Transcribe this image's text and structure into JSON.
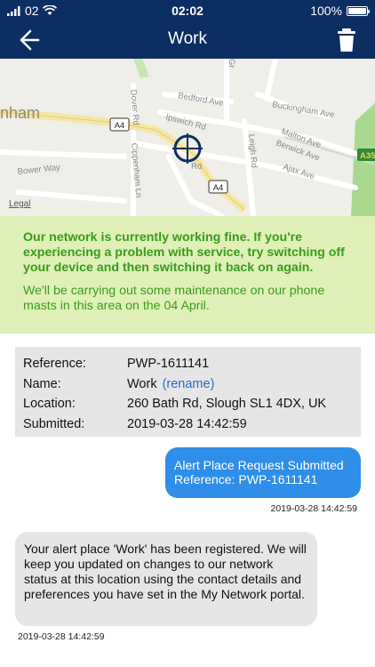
{
  "status_bar": {
    "carrier": "02",
    "time": "02:02",
    "battery_percent": "100%",
    "battery_level": 1.0
  },
  "nav": {
    "title": "Work",
    "back_icon": "back-arrow-icon",
    "delete_icon": "trash-icon"
  },
  "map": {
    "place_labels": {
      "town": "nham",
      "bedford": "Bedford Ave",
      "buckingham": "Buckingham Ave",
      "dover": "Dover Rd",
      "ipswich": "Ipswich Rd",
      "malton": "Malton Ave",
      "berwick": "Berwick Ave",
      "cippenham": "Cippenham Ln",
      "leigh": "Leigh Rd",
      "bower": "Bower Way",
      "ajax": "Ajax Ave",
      "rd": "Rd",
      "gr": "Gr"
    },
    "road_badges": {
      "a4_left": "A4",
      "a4_right": "A4",
      "a355": "A35"
    },
    "legal": "Legal"
  },
  "notice": {
    "bold_text": "Our network is currently working fine. If you're experiencing a problem with service, try switching off your device and then switching it back on again.",
    "normal_text": "We'll be carrying out some maintenance on our phone masts in this area on the 04 April."
  },
  "details": {
    "reference_label": "Reference:",
    "reference_value": "PWP-1611141",
    "name_label": "Name:",
    "name_value": "Work",
    "rename_link": "(rename)",
    "location_label": "Location:",
    "location_value": "260 Bath Rd, Slough SL1 4DX, UK",
    "submitted_label": "Submitted:",
    "submitted_value": "2019-03-28 14:42:59"
  },
  "messages": {
    "outgoing_line1": "Alert Place Request Submitted",
    "outgoing_line2": "Reference: PWP-1611141",
    "outgoing_timestamp": "2019-03-28 14:42:59",
    "incoming_text": "Your alert place 'Work' has been registered. We will keep you updated on changes to our network status at this location using the contact details and preferences you have set in the My Network portal.",
    "incoming_timestamp": "2019-03-28 14:42:59"
  },
  "colors": {
    "header": "#0b2e63",
    "notice_bg": "#dff1b8",
    "notice_text": "#3a9b1b",
    "outgoing_bubble": "#2f8ee8",
    "incoming_bubble": "#e6e6e6",
    "link": "#2a68c4"
  }
}
